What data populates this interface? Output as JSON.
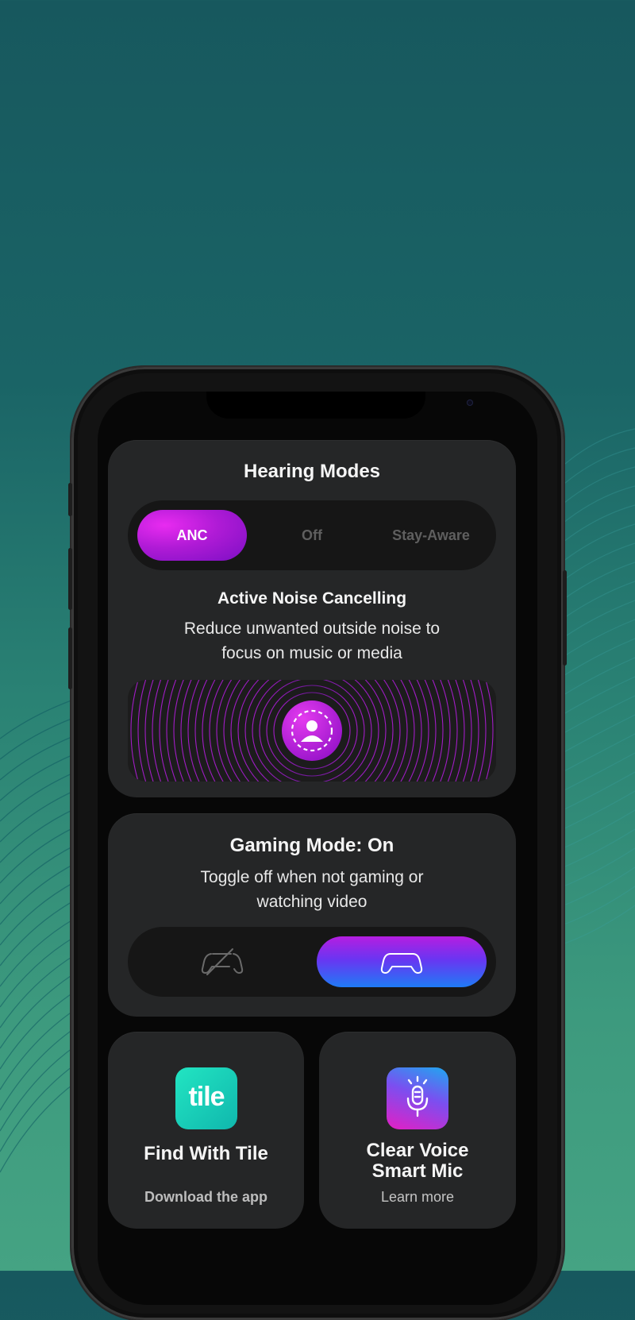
{
  "colors": {
    "background_top": "#17585e",
    "background_bottom": "#45a383",
    "card": "#252627",
    "accent_magenta": "#c41fe0",
    "accent_blue": "#1f7bf5"
  },
  "hearing_modes": {
    "title": "Hearing Modes",
    "modes": [
      "ANC",
      "Off",
      "Stay-Aware"
    ],
    "selected": "ANC",
    "mode_title": "Active Noise Cancelling",
    "mode_description_line1": "Reduce unwanted outside noise to",
    "mode_description_line2": "focus on music or media",
    "visual_icon": "person-focus-icon"
  },
  "gaming_mode": {
    "title": "Gaming Mode: On",
    "description_line1": "Toggle off when not gaming or",
    "description_line2": "watching video",
    "off_icon": "gamepad-off-icon",
    "on_icon": "gamepad-icon",
    "state": "on"
  },
  "tile_card": {
    "logo_text": "tile",
    "title": "Find With Tile",
    "subtitle": "Download the app"
  },
  "mic_card": {
    "icon": "microphone-icon",
    "title_line1": "Clear Voice",
    "title_line2": "Smart Mic",
    "subtitle": "Learn more"
  }
}
